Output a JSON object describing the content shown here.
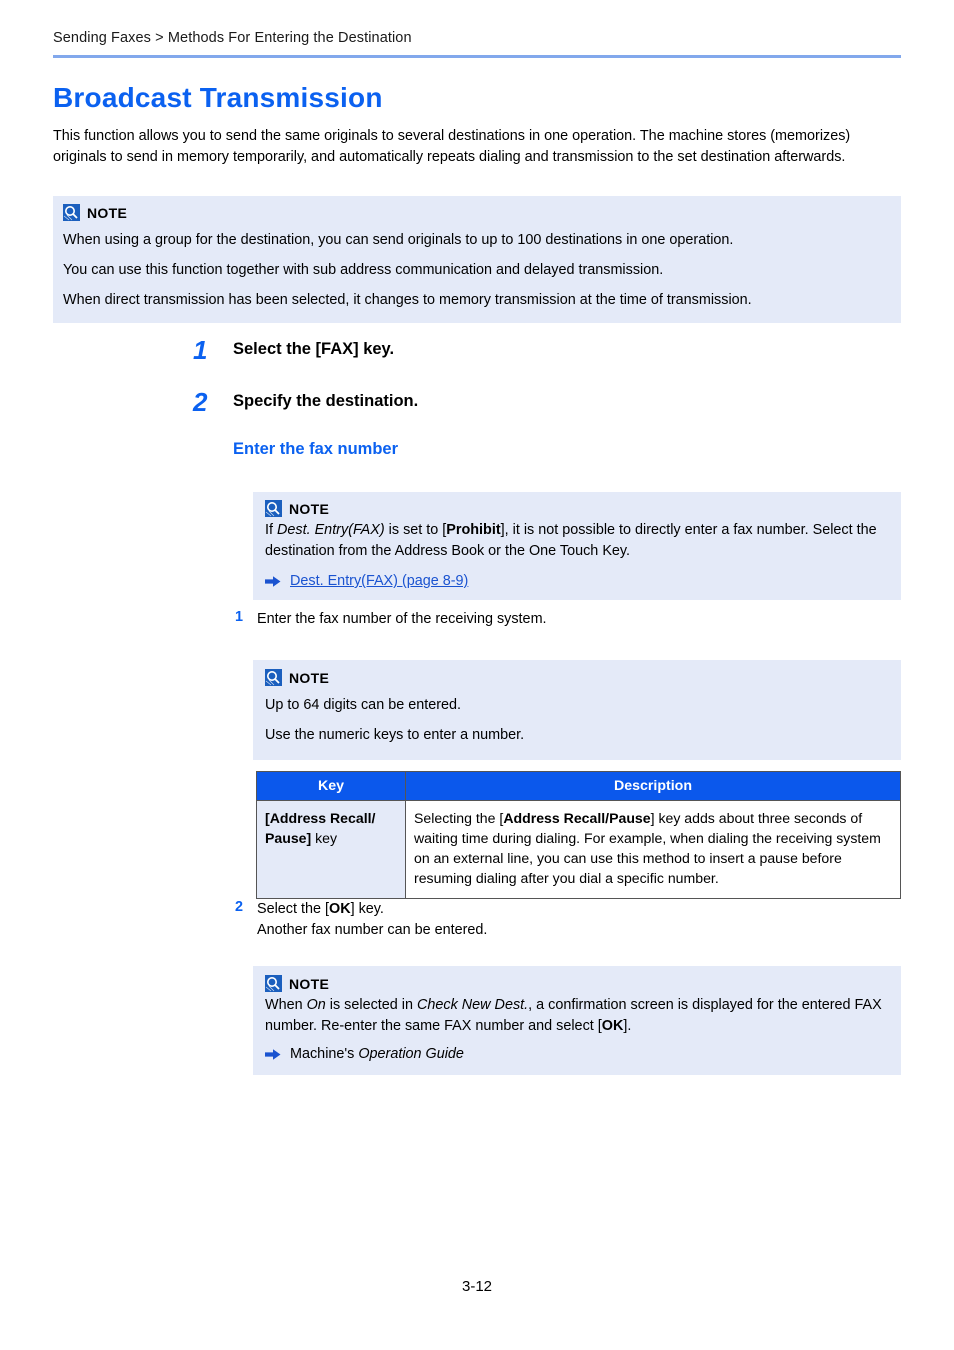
{
  "header": {
    "breadcrumb": "Sending Faxes > Methods For Entering the Destination"
  },
  "title": "Broadcast Transmission",
  "intro": "This function allows you to send the same originals to several destinations in one operation. The machine stores (memorizes) originals to send in memory temporarily, and automatically repeats dialing and transmission to the set destination afterwards.",
  "note_label": "NOTE",
  "note1": {
    "lines": [
      "When using a group for the destination, you can send originals to up to 100 destinations in one operation.",
      "You can use this function together with sub address communication and delayed transmission.",
      "When direct transmission has been selected, it changes to memory transmission at the time of transmission."
    ]
  },
  "steps": [
    {
      "num": "1",
      "title": "Select the [FAX] key."
    },
    {
      "num": "2",
      "title": "Specify the destination."
    }
  ],
  "subheading": "Enter the fax number",
  "note2": {
    "text_part1": "If ",
    "italic1": "Dest. Entry(FAX)",
    "text_part2": " is set to [",
    "bold1": "Prohibit",
    "text_part3": "], it is not possible to directly enter a fax number. Select the destination from the Address Book or the One Touch Key.",
    "xref_link": "Dest. Entry(FAX) (page 8-9)"
  },
  "substep1": {
    "num": "1",
    "text": "Enter the fax number of the receiving system."
  },
  "note3": {
    "lines": [
      "Up to 64 digits can be entered.",
      "Use the numeric keys to enter a number."
    ]
  },
  "table": {
    "headers": [
      "Key",
      "Description"
    ],
    "rows": [
      {
        "key_bold": "[Address Recall/ Pause]",
        "key_suffix": " key",
        "desc_part1": "Selecting the [",
        "desc_bold": "Address Recall/Pause",
        "desc_part2": "] key adds about three seconds of waiting time during dialing. For example, when dialing the receiving system on an external line, you can use this method to insert a pause before resuming dialing after you dial a specific number."
      }
    ]
  },
  "substep2": {
    "num": "2",
    "line1_part1": "Select the [",
    "line1_bold": "OK",
    "line1_part2": "] key.",
    "line2": "Another fax number can be entered."
  },
  "note4": {
    "text_part1": "When ",
    "italic1": "On",
    "text_part2": " is selected in ",
    "italic2": "Check New Dest.",
    "text_part3": ", a confirmation screen is displayed for the entered FAX number. Re-enter the same FAX number and select [",
    "bold1": "OK",
    "text_part4": "].",
    "xref_prefix": "Machine's ",
    "xref_italic": "Operation Guide"
  },
  "footer": {
    "page_number": "3-12"
  },
  "colors": {
    "accent_blue": "#0b61f0",
    "table_header_blue": "#0b58ec",
    "note_background": "#e4eaf8",
    "rule_blue": "#82a8ec",
    "link_blue": "#1a53d0"
  },
  "icons": {
    "note": "note-magnifier-icon",
    "xref": "right-arrow-icon"
  }
}
